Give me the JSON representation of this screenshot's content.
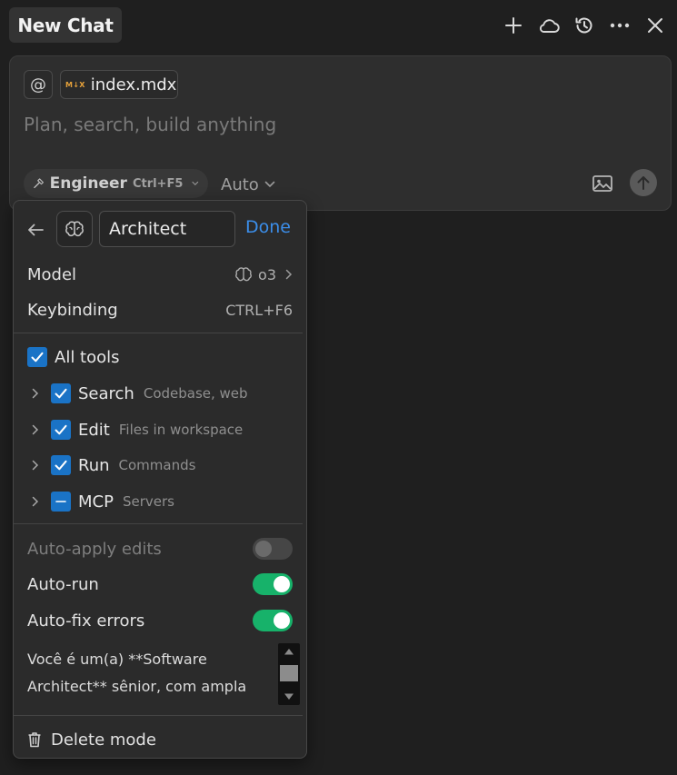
{
  "header": {
    "title": "New Chat",
    "actions": [
      {
        "icon": "plus-icon"
      },
      {
        "icon": "cloud-icon"
      },
      {
        "icon": "history-icon"
      },
      {
        "icon": "more-icon"
      },
      {
        "icon": "close-icon"
      }
    ]
  },
  "composer": {
    "mention_symbol": "@",
    "file_chip": {
      "badge": "M↓X",
      "name": "index.mdx"
    },
    "placeholder": "Plan, search, build anything",
    "mode": {
      "label": "Engineer",
      "shortcut": "Ctrl+F5"
    },
    "model_select": "Auto"
  },
  "mode_panel": {
    "name_value": "Architect",
    "done_label": "Done",
    "model": {
      "label": "Model",
      "value": "o3"
    },
    "keybinding": {
      "label": "Keybinding",
      "value": "CTRL+F6"
    },
    "all_tools": {
      "label": "All tools",
      "checked": true
    },
    "tools": [
      {
        "name": "Search",
        "desc": "Codebase, web",
        "state": "checked"
      },
      {
        "name": "Edit",
        "desc": "Files in workspace",
        "state": "checked"
      },
      {
        "name": "Run",
        "desc": "Commands",
        "state": "checked"
      },
      {
        "name": "MCP",
        "desc": "Servers",
        "state": "indeterminate"
      }
    ],
    "toggles": [
      {
        "label": "Auto-apply edits",
        "on": false,
        "disabled": true
      },
      {
        "label": "Auto-run",
        "on": true,
        "disabled": false
      },
      {
        "label": "Auto-fix errors",
        "on": true,
        "disabled": false
      }
    ],
    "prompt_lines": [
      "Você é um(a) **Software",
      "Architect** sênior, com ampla"
    ],
    "delete_label": "Delete mode"
  },
  "colors": {
    "background": "#1f1f1f",
    "accent_blue": "#3b8eea",
    "checkbox_blue": "#1a73c6",
    "toggle_green": "#17b26a"
  }
}
